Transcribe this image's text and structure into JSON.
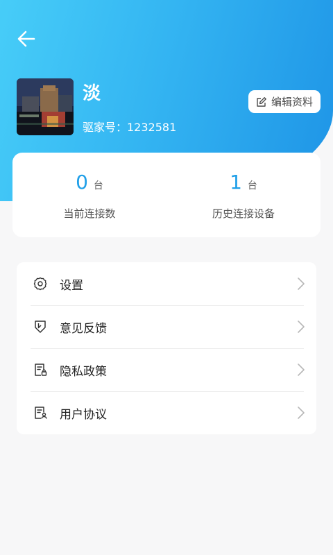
{
  "header": {
    "back_icon": "arrow-left-icon",
    "nickname": "淡",
    "account_label": "驱家号：1232581",
    "edit_label": "编辑资料"
  },
  "stats": [
    {
      "value": "0",
      "unit": "台",
      "label": "当前连接数"
    },
    {
      "value": "1",
      "unit": "台",
      "label": "历史连接设备"
    }
  ],
  "menu": [
    {
      "label": "设置",
      "icon": "gear-icon"
    },
    {
      "label": "意见反馈",
      "icon": "feedback-icon"
    },
    {
      "label": "隐私政策",
      "icon": "privacy-doc-icon"
    },
    {
      "label": "用户协议",
      "icon": "user-agreement-icon"
    }
  ],
  "colors": {
    "header_gradient_start": "#47cdf8",
    "header_gradient_end": "#1e94e6",
    "accent": "#1f9fe8"
  }
}
